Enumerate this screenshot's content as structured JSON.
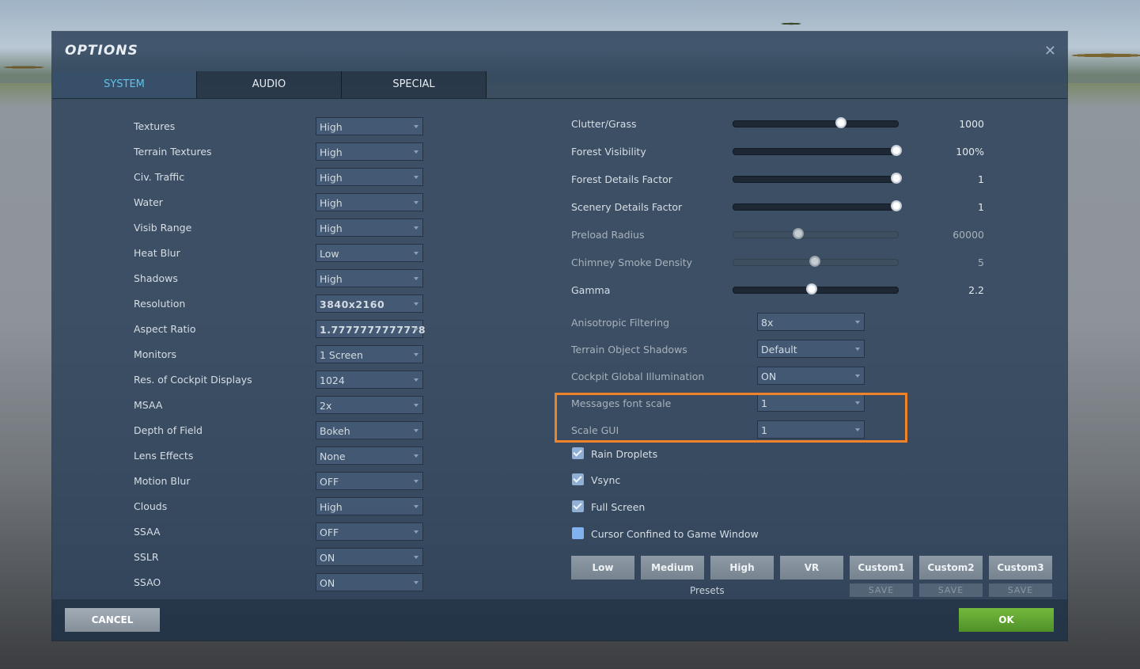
{
  "dialog": {
    "title": "OPTIONS",
    "close_glyph": "✕"
  },
  "tabs": [
    "SYSTEM",
    "AUDIO",
    "SPECIAL"
  ],
  "left_settings": [
    {
      "label": "Textures",
      "value": "High"
    },
    {
      "label": "Terrain Textures",
      "value": "High"
    },
    {
      "label": "Civ. Traffic",
      "value": "High"
    },
    {
      "label": "Water",
      "value": "High"
    },
    {
      "label": "Visib Range",
      "value": "High"
    },
    {
      "label": "Heat Blur",
      "value": "Low"
    },
    {
      "label": "Shadows",
      "value": "High"
    },
    {
      "label": "Resolution",
      "value": "3840x2160"
    },
    {
      "label": "Aspect Ratio",
      "value": "1.7777777777778"
    },
    {
      "label": "Monitors",
      "value": "1 Screen"
    },
    {
      "label": "Res. of Cockpit Displays",
      "value": "1024"
    },
    {
      "label": "MSAA",
      "value": "2x"
    },
    {
      "label": "Depth of Field",
      "value": "Bokeh"
    },
    {
      "label": "Lens Effects",
      "value": "None"
    },
    {
      "label": "Motion Blur",
      "value": "OFF"
    },
    {
      "label": "Clouds",
      "value": "High"
    },
    {
      "label": "SSAA",
      "value": "OFF"
    },
    {
      "label": "SSLR",
      "value": "ON"
    },
    {
      "label": "SSAO",
      "value": "ON"
    }
  ],
  "sliders": [
    {
      "label": "Clutter/Grass",
      "value": "1000",
      "level": 0.66
    },
    {
      "label": "Forest Visibility",
      "value": "100%",
      "level": 1.0
    },
    {
      "label": "Forest Details Factor",
      "value": "1",
      "level": 1.0
    },
    {
      "label": "Scenery Details Factor",
      "value": "1",
      "level": 1.0
    },
    {
      "label": "Preload Radius",
      "value": "60000",
      "level": 0.4
    },
    {
      "label": "Chimney Smoke Density",
      "value": "5",
      "level": 0.5
    },
    {
      "label": "Gamma",
      "value": "2.2",
      "level": 0.48
    }
  ],
  "right_settings": [
    {
      "label": "Anisotropic Filtering",
      "value": "8x"
    },
    {
      "label": "Terrain Object Shadows",
      "value": "Default"
    },
    {
      "label": "Cockpit Global Illumination",
      "value": "ON"
    },
    {
      "label": "Messages font scale",
      "value": "1"
    },
    {
      "label": "Scale GUI",
      "value": "1"
    }
  ],
  "checkboxes": [
    {
      "label": "Rain Droplets",
      "checked": true
    },
    {
      "label": "Vsync",
      "checked": true
    },
    {
      "label": "Full Screen",
      "checked": true
    },
    {
      "label": "Cursor Confined to Game Window",
      "checked": false
    }
  ],
  "presets": {
    "label": "Presets",
    "buttons": [
      "Low",
      "Medium",
      "High",
      "VR",
      "Custom1",
      "Custom2",
      "Custom3"
    ],
    "save_label": "SAVE"
  },
  "footer": {
    "cancel_label": "CANCEL",
    "ok_label": "OK"
  },
  "colors": {
    "accent_tab": "#5fc2e8",
    "highlight": "#f0822a",
    "ok": "#5fa32f"
  }
}
